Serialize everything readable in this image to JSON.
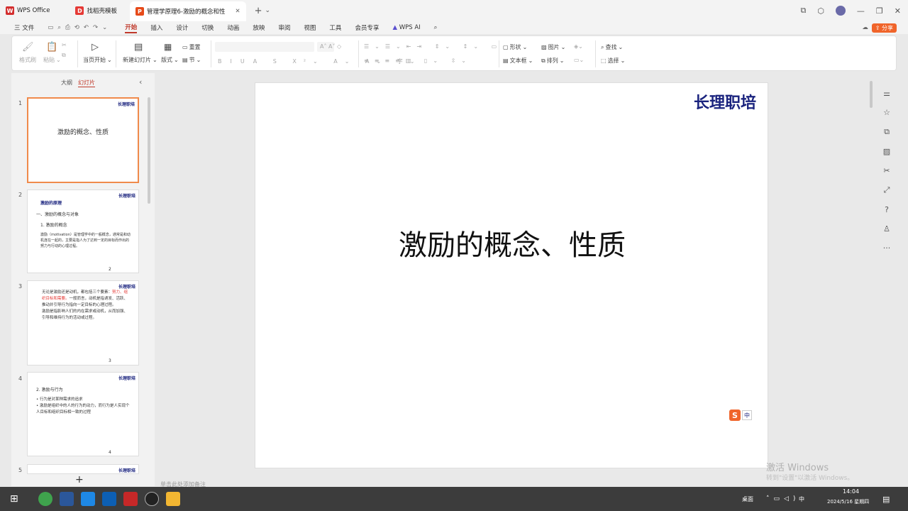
{
  "tabs": [
    {
      "label": "WPS Office",
      "icon": "wps-logo"
    },
    {
      "label": "找稻壳模板",
      "icon": "docer-logo"
    },
    {
      "label": "管理学原理6-激励的概念和性",
      "icon": "ppt-logo"
    }
  ],
  "menu": [
    "三 文件",
    "开始",
    "插入",
    "设计",
    "切换",
    "动画",
    "放映",
    "审阅",
    "视图",
    "工具",
    "会员专享",
    "WPS AI"
  ],
  "share_label": "分享",
  "ribbon": {
    "format_painter": "格式刷",
    "paste": "粘贴",
    "from_current": "当页开始",
    "new_slide": "新建幻灯片",
    "layout": "版式",
    "reset": "重置",
    "section": "节",
    "bold": "B",
    "italic": "I",
    "underline": "U",
    "shape": "形状",
    "picture": "图片",
    "textbox": "文本框",
    "arrange": "排列",
    "find": "查找",
    "select": "选择"
  },
  "left_panel": {
    "tab_outline": "大纲",
    "tab_slides": "幻灯片",
    "add_button": "+"
  },
  "thumbnails": [
    {
      "num": "1",
      "brand": "长理职培",
      "title": "激励的概念、性质"
    },
    {
      "num": "2",
      "brand": "长理职培",
      "heading": "激励的原理",
      "sub1": "一、激励的概念与对象",
      "sub2": "1. 激励的概念",
      "body": "激励（motivation）是管理学中的一般概念，通常是和动机连在一起的，主要是指人为了达到一定的目标而作出的努力与行动的心理过程。",
      "page": "2"
    },
    {
      "num": "3",
      "brand": "长理职培",
      "l1": "无论是激励还是动机，都包括三个要素：",
      "l2": "努力、组织目标和需要。",
      "l3": "一般而言，动机是指诱发、活跃、推动并引导行为指向一定目标的心理过程。",
      "l4": "激励是指影响人们的内在需求或动机，从而加强、引导和维持行为的活动或过程。",
      "page": "3"
    },
    {
      "num": "4",
      "brand": "长理职培",
      "h": "2. 激励与行为",
      "b1": "行为是对某种需求的追求",
      "b2": "激励是组织中的人的行为的动力，而行为是人实现个人目标和组织目标相一致的过程",
      "page": "4"
    },
    {
      "num": "5",
      "brand": "长理职培"
    }
  ],
  "slide": {
    "brand": "长理职培",
    "title": "激励的概念、性质",
    "ime": "中"
  },
  "notes_placeholder": "单击此处添加备注",
  "watermark": {
    "line1": "激活 Windows",
    "line2": "转到\"设置\"以激活 Windows。"
  },
  "taskbar": {
    "desktop": "桌面",
    "time": "14:04",
    "date": "2024/5/16 星期四",
    "ime": "中"
  },
  "colors": {
    "accent": "#c0392b",
    "brand": "#1a237e",
    "share": "#f0642a"
  }
}
